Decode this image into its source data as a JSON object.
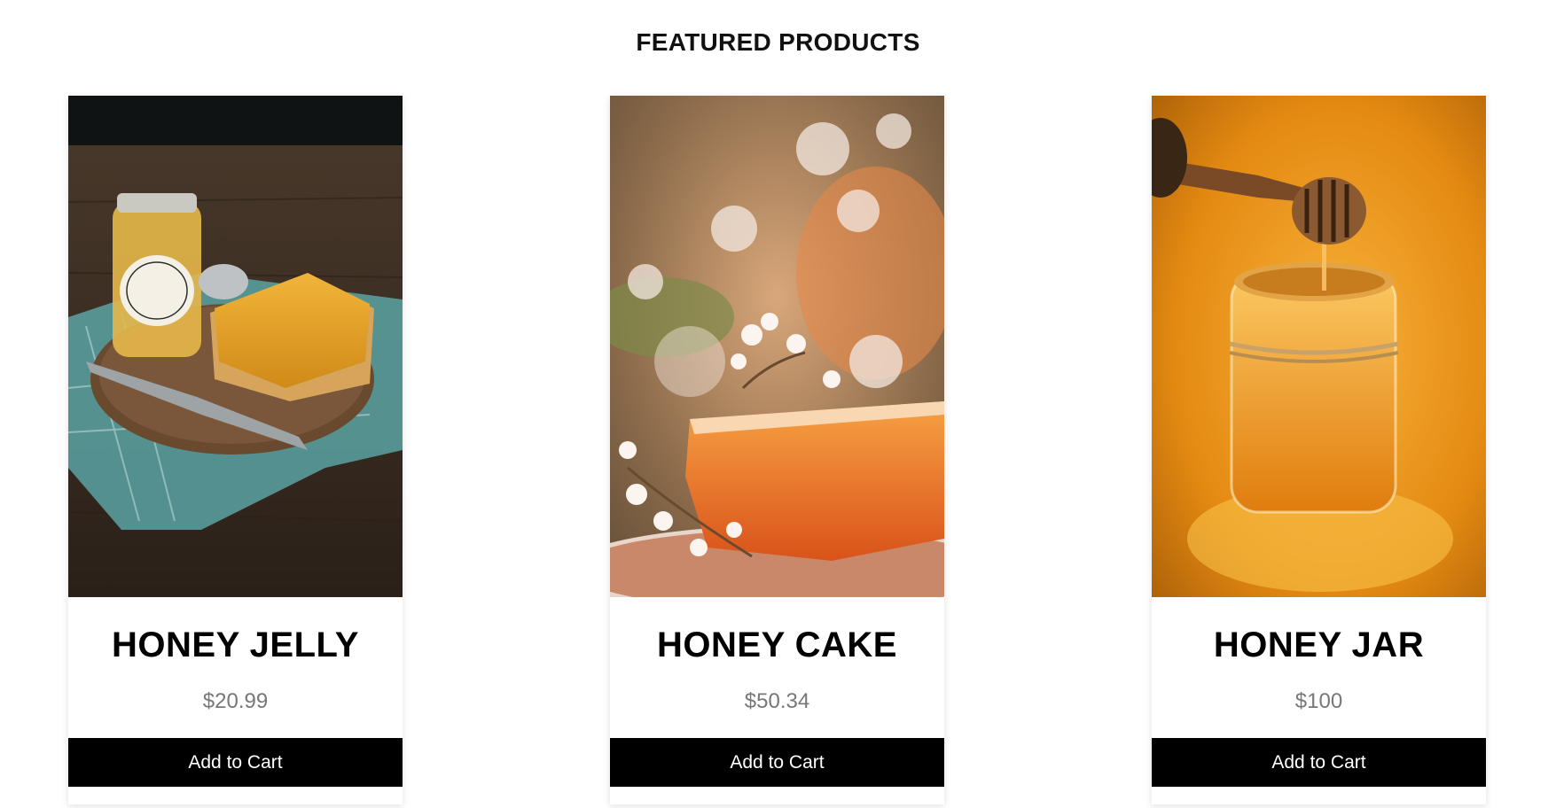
{
  "section": {
    "title": "FEATURED PRODUCTS"
  },
  "products": [
    {
      "name": "HONEY JELLY",
      "price": "$20.99",
      "button_label": "Add to Cart",
      "image": "honey-jelly-toast-photo"
    },
    {
      "name": "HONEY CAKE",
      "price": "$50.34",
      "button_label": "Add to Cart",
      "image": "honeycomb-blossom-photo"
    },
    {
      "name": "HONEY JAR",
      "price": "$100",
      "button_label": "Add to Cart",
      "image": "honey-jar-dipper-photo"
    }
  ],
  "colors": {
    "button_bg": "#000000",
    "button_text": "#ffffff",
    "price_text": "#777777",
    "title_text": "#000000"
  }
}
